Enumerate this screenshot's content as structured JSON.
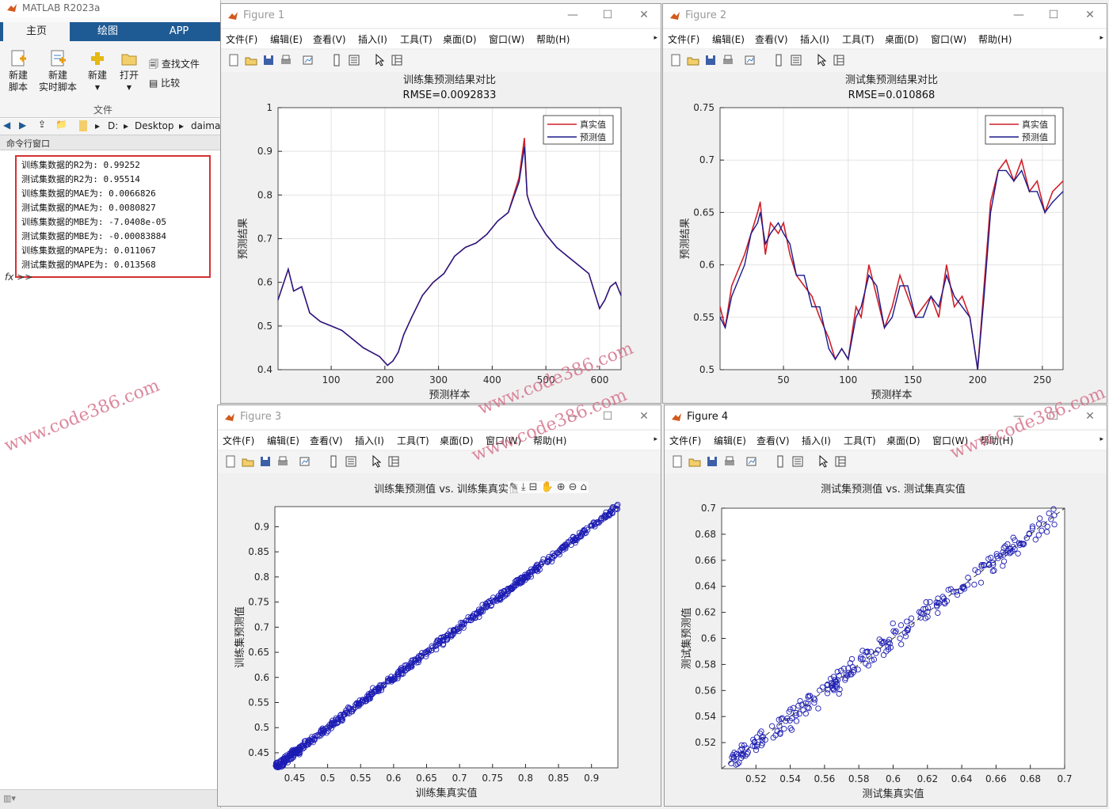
{
  "app": {
    "title": "MATLAB R2023a",
    "tabs": [
      "主页",
      "绘图",
      "APP"
    ],
    "ribbon": {
      "new_script": "新建\n脚本",
      "new_live_script": "新建\n实时脚本",
      "new": "新建",
      "open": "打开",
      "find_files": "查找文件",
      "compare": "比较",
      "group_label": "文件"
    },
    "path": [
      "D:",
      "Desktop",
      "daima"
    ],
    "command_window_title": "命令行窗口",
    "command_output": [
      "训练集数据的R2为: 0.99252",
      "测试集数据的R2为: 0.95514",
      "训练集数据的MAE为: 0.0066826",
      "测试集数据的MAE为: 0.0080827",
      "训练集数据的MBE为: -7.0408e-05",
      "测试集数据的MBE为: -0.00083884",
      "训练集数据的MAPE为: 0.011067",
      "测试集数据的MAPE为: 0.013568"
    ],
    "prompt": "fx >>"
  },
  "menu": [
    "文件(F)",
    "编辑(E)",
    "查看(V)",
    "插入(I)",
    "工具(T)",
    "桌面(D)",
    "窗口(W)",
    "帮助(H)"
  ],
  "watermark": "www.code386.com",
  "colors": {
    "true_line": "#d0202a",
    "pred_line": "#1a1a8c",
    "scatter": "#1c1cb4",
    "titlebar_blue": "#1e5b94",
    "highlight_red": "#d23333"
  },
  "figures": [
    {
      "name": "Figure 1",
      "chart_data": {
        "type": "line",
        "title": "训练集预测结果对比",
        "subtitle": "RMSE=0.0092833",
        "xlabel": "预测样本",
        "ylabel": "预测结果",
        "xlim": [
          1,
          640
        ],
        "ylim": [
          0.4,
          1.0
        ],
        "xticks": [
          100,
          200,
          300,
          400,
          500,
          600
        ],
        "yticks": [
          0.4,
          0.5,
          0.6,
          0.7,
          0.8,
          0.9,
          1
        ],
        "legend": [
          "真实值",
          "预测值"
        ],
        "legend_position": "top-right",
        "grid": true,
        "series": [
          {
            "name": "真实值",
            "x": [
              1,
              20,
              30,
              45,
              60,
              80,
              100,
              120,
              140,
              160,
              175,
              190,
              205,
              215,
              225,
              235,
              250,
              270,
              290,
              310,
              330,
              350,
              370,
              390,
              410,
              430,
              450,
              460,
              465,
              470,
              480,
              500,
              520,
              540,
              560,
              580,
              600,
              610,
              620,
              630,
              640
            ],
            "y": [
              0.56,
              0.63,
              0.58,
              0.59,
              0.53,
              0.51,
              0.5,
              0.49,
              0.47,
              0.45,
              0.44,
              0.43,
              0.41,
              0.42,
              0.44,
              0.48,
              0.52,
              0.57,
              0.6,
              0.62,
              0.66,
              0.68,
              0.69,
              0.71,
              0.74,
              0.76,
              0.84,
              0.93,
              0.8,
              0.78,
              0.75,
              0.71,
              0.68,
              0.66,
              0.64,
              0.62,
              0.54,
              0.56,
              0.59,
              0.6,
              0.57
            ]
          },
          {
            "name": "预测值",
            "x": [
              1,
              20,
              30,
              45,
              60,
              80,
              100,
              120,
              140,
              160,
              175,
              190,
              205,
              215,
              225,
              235,
              250,
              270,
              290,
              310,
              330,
              350,
              370,
              390,
              410,
              430,
              450,
              460,
              465,
              470,
              480,
              500,
              520,
              540,
              560,
              580,
              600,
              610,
              620,
              630,
              640
            ],
            "y": [
              0.56,
              0.63,
              0.58,
              0.59,
              0.53,
              0.51,
              0.5,
              0.49,
              0.47,
              0.45,
              0.44,
              0.43,
              0.41,
              0.42,
              0.44,
              0.48,
              0.52,
              0.57,
              0.6,
              0.62,
              0.66,
              0.68,
              0.69,
              0.71,
              0.74,
              0.76,
              0.83,
              0.91,
              0.8,
              0.78,
              0.75,
              0.71,
              0.68,
              0.66,
              0.64,
              0.62,
              0.54,
              0.56,
              0.59,
              0.6,
              0.57
            ]
          }
        ]
      }
    },
    {
      "name": "Figure 2",
      "chart_data": {
        "type": "line",
        "title": "测试集预测结果对比",
        "subtitle": "RMSE=0.010868",
        "xlabel": "预测样本",
        "ylabel": "预测结果",
        "xlim": [
          1,
          266
        ],
        "ylim": [
          0.5,
          0.75
        ],
        "xticks": [
          50,
          100,
          150,
          200,
          250
        ],
        "yticks": [
          0.5,
          0.55,
          0.6,
          0.65,
          0.7,
          0.75
        ],
        "legend": [
          "真实值",
          "预测值"
        ],
        "legend_position": "top-right",
        "grid": true,
        "series": [
          {
            "name": "真实值",
            "x": [
              1,
              5,
              10,
              20,
              25,
              30,
              32,
              36,
              40,
              46,
              50,
              55,
              60,
              66,
              72,
              78,
              85,
              90,
              95,
              100,
              106,
              110,
              116,
              122,
              128,
              134,
              140,
              146,
              152,
              158,
              164,
              170,
              176,
              182,
              188,
              194,
              200,
              205,
              210,
              216,
              222,
              228,
              234,
              240,
              246,
              252,
              258,
              266
            ],
            "y": [
              0.56,
              0.54,
              0.58,
              0.61,
              0.63,
              0.65,
              0.66,
              0.61,
              0.64,
              0.63,
              0.64,
              0.61,
              0.59,
              0.58,
              0.57,
              0.55,
              0.53,
              0.51,
              0.52,
              0.51,
              0.56,
              0.55,
              0.6,
              0.57,
              0.54,
              0.56,
              0.59,
              0.57,
              0.55,
              0.56,
              0.57,
              0.55,
              0.6,
              0.56,
              0.57,
              0.55,
              0.5,
              0.58,
              0.66,
              0.69,
              0.7,
              0.68,
              0.7,
              0.67,
              0.68,
              0.65,
              0.67,
              0.68
            ]
          },
          {
            "name": "预测值",
            "x": [
              1,
              5,
              10,
              20,
              25,
              30,
              32,
              36,
              40,
              46,
              50,
              55,
              60,
              66,
              72,
              78,
              85,
              90,
              95,
              100,
              106,
              110,
              116,
              122,
              128,
              134,
              140,
              146,
              152,
              158,
              164,
              170,
              176,
              182,
              188,
              194,
              200,
              205,
              210,
              216,
              222,
              228,
              234,
              240,
              246,
              252,
              258,
              266
            ],
            "y": [
              0.55,
              0.54,
              0.57,
              0.6,
              0.63,
              0.64,
              0.65,
              0.62,
              0.63,
              0.64,
              0.63,
              0.62,
              0.59,
              0.59,
              0.56,
              0.56,
              0.52,
              0.51,
              0.52,
              0.51,
              0.55,
              0.56,
              0.59,
              0.58,
              0.54,
              0.55,
              0.58,
              0.58,
              0.55,
              0.55,
              0.57,
              0.56,
              0.59,
              0.57,
              0.56,
              0.55,
              0.5,
              0.57,
              0.65,
              0.69,
              0.69,
              0.68,
              0.69,
              0.67,
              0.67,
              0.65,
              0.66,
              0.67
            ]
          }
        ]
      }
    },
    {
      "name": "Figure 3",
      "chart_data": {
        "type": "scatter",
        "title": "训练集预测值 vs. 训练集真实值",
        "xlabel": "训练集真实值",
        "ylabel": "训练集预测值",
        "xlim": [
          0.42,
          0.94
        ],
        "ylim": [
          0.42,
          0.94
        ],
        "xticks": [
          0.45,
          0.5,
          0.55,
          0.6,
          0.65,
          0.7,
          0.75,
          0.8,
          0.85,
          0.9
        ],
        "yticks": [
          0.45,
          0.5,
          0.55,
          0.6,
          0.65,
          0.7,
          0.75,
          0.8,
          0.85,
          0.9
        ],
        "reference_line": "y = x (dashed)",
        "grid": false,
        "points": {
          "x_range": [
            0.42,
            0.94
          ],
          "count": 620,
          "noise": 0.007
        }
      }
    },
    {
      "name": "Figure 4",
      "chart_data": {
        "type": "scatter",
        "title": "测试集预测值 vs. 测试集真实值",
        "xlabel": "测试集真实值",
        "ylabel": "测试集预测值",
        "xlim": [
          0.5,
          0.7
        ],
        "ylim": [
          0.5,
          0.7
        ],
        "xticks": [
          0.52,
          0.54,
          0.56,
          0.58,
          0.6,
          0.62,
          0.64,
          0.66,
          0.68,
          0.7
        ],
        "yticks": [
          0.52,
          0.54,
          0.56,
          0.58,
          0.6,
          0.62,
          0.64,
          0.66,
          0.68,
          0.7
        ],
        "reference_line": "y = x (dashed)",
        "grid": false,
        "points": {
          "x_range": [
            0.505,
            0.695
          ],
          "count": 266,
          "noise": 0.008
        }
      }
    }
  ]
}
